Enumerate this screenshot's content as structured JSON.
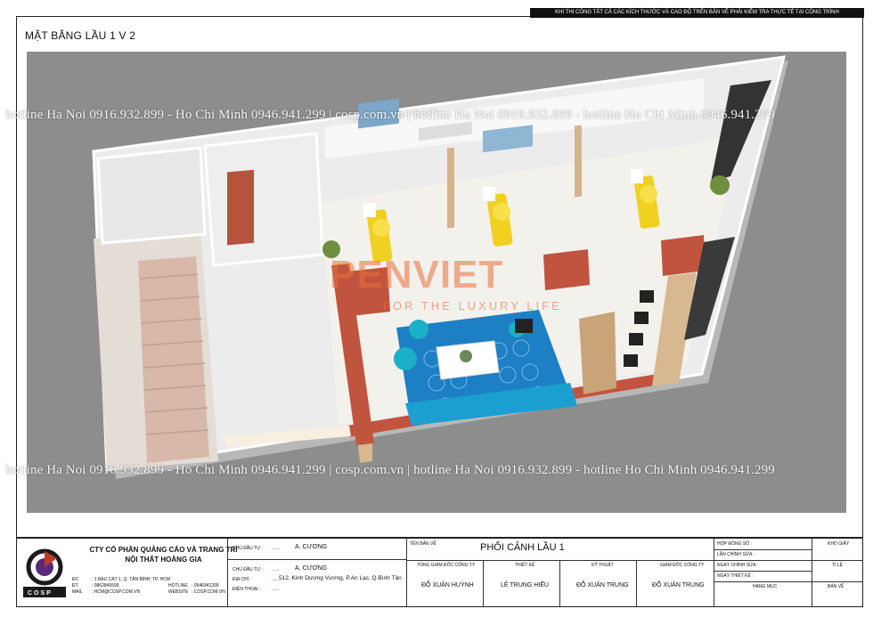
{
  "sheet": {
    "top_note": "KHI THI CÔNG TẤT CẢ CÁC KÍCH THƯỚC VÀ CAO ĐỘ TRÊN BẢN VẼ PHẢI KIỂM TRA THỰC TẾ TẠI CÔNG TRÌNH",
    "drawing_title": "MẶT BẰNG LẦU 1 V 2",
    "watermark": "hotline Ha Noi 0916.932.899 - Ho Chi Minh 0946.941.299 | cosp.com.vn | hotline Ha Noi 0916.932.899 - hotline Ho Chi Minh 0946.941.299",
    "brand_name": "PENVIET",
    "brand_tagline": "FOR THE LUXURY LIFE"
  },
  "title_block": {
    "logo_text": "COSP",
    "company_line1": "CTY CỔ PHẦN QUẢNG CÁO VÀ TRANG TRÍ",
    "company_line2": "NỘI THẤT HOÀNG GIA",
    "address_label": "ĐC",
    "address": ": 1 BÀU CÁT 1, Q. TÂN BÌNH, TP. HCM",
    "tel_label": "ĐT",
    "tel": ": 0862845599",
    "email_label": "MAIL",
    "email": ": HCM@COSP.COM.VN",
    "hotline_label": "HOTLINE",
    "hotline": ": 0946941299",
    "website_label": "WEBSITE",
    "website": ": COSP.COM.VN",
    "investor_label": "CHỦ ĐẦU TƯ :",
    "investor_dots": "......",
    "investor_name": "A.    CƯƠNG",
    "owner_label": "CHỦ ĐẦU TƯ :",
    "owner_dots": "......",
    "owner_name": "A.    CƯƠNG",
    "location_label": "ĐỊA CHỈ :",
    "location_dots": "......",
    "location": "512, Kinh Dương Vương, P.An Lạc, Q.Bình Tân",
    "phone_label": "ĐIỆN THOẠI :",
    "phone_dots": "......",
    "drawing_name_label": "TÊN BẢN VẼ",
    "drawing_name": "PHỐI CẢNH LẦU 1",
    "roles": [
      {
        "label": "TỔNG GIÁM ĐỐC CÔNG TY",
        "name": "ĐỖ XUÂN HUỲNH"
      },
      {
        "label": "THIẾT KẾ",
        "name": "LÊ TRUNG HIẾU"
      },
      {
        "label": "KỸ THUẬT",
        "name": "ĐỖ XUÂN TRUNG"
      },
      {
        "label": "GIÁM ĐỐC CÔNG TY",
        "name": "ĐỖ XUÂN TRUNG"
      }
    ],
    "meta": [
      {
        "label": "HỢP ĐỒNG SỐ :"
      },
      {
        "label": "LẦN CHỈNH SỬA :"
      },
      {
        "label": "NGÀY CHỈNH SỬA :"
      },
      {
        "label": "NGÀY THIẾT KẾ :"
      },
      {
        "label": "HẠNG MỤC"
      }
    ],
    "side": [
      {
        "label": "KHỔ GIẤY"
      },
      {
        "label": "TỈ LỆ"
      },
      {
        "label": "BẢN VẼ"
      }
    ]
  }
}
